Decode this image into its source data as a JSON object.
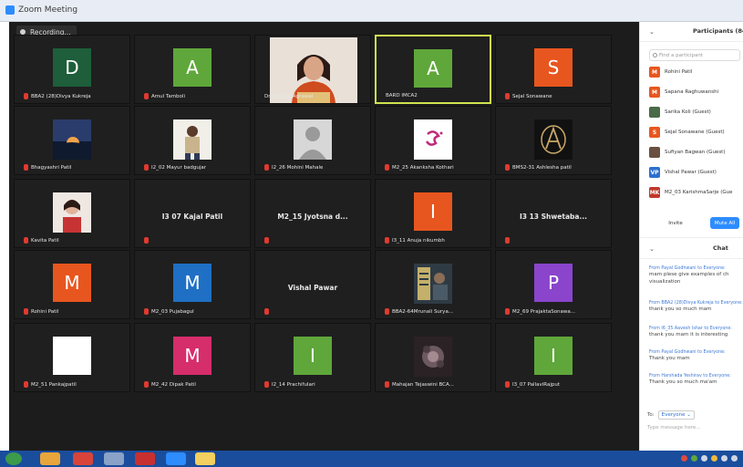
{
  "window": {
    "title": "Zoom Meeting"
  },
  "recording": {
    "label": "Recording..."
  },
  "tiles": [
    {
      "kind": "avatar",
      "letter": "D",
      "color": "#1e5e3a",
      "name": "BBA2 (28)Divya Kukreja",
      "muted": true
    },
    {
      "kind": "avatar",
      "letter": "A",
      "color": "#5fa73a",
      "name": "Amul Tamboli",
      "muted": true
    },
    {
      "kind": "video",
      "name": "Dr. Monika Agrawal",
      "muted": false
    },
    {
      "kind": "avatar",
      "letter": "A",
      "color": "#5fa73a",
      "name": "BARD IMCA2",
      "muted": false,
      "active": true
    },
    {
      "kind": "avatar",
      "letter": "S",
      "color": "#e8561f",
      "name": "Sejal Sonawane",
      "muted": true
    },
    {
      "kind": "photo",
      "photo": "sunset",
      "name": "Bhagyashri Patil",
      "muted": true
    },
    {
      "kind": "photo",
      "photo": "man",
      "name": "I2_02 Mayur badgujar",
      "muted": true
    },
    {
      "kind": "photo",
      "photo": "silhouette",
      "name": "I2_26 Mohini Mahale",
      "muted": true
    },
    {
      "kind": "photo",
      "photo": "letter-pink",
      "name": "M2_25 Akanksha Kothari",
      "muted": true
    },
    {
      "kind": "photo",
      "photo": "letter-gold",
      "name": "BMS2-31 Ashlesha patil",
      "muted": true
    },
    {
      "kind": "photo",
      "photo": "girl",
      "name": "Kavita Patil",
      "muted": true
    },
    {
      "kind": "text",
      "center": "I3 07 Kajal Patil",
      "name": "",
      "muted": true
    },
    {
      "kind": "text",
      "center": "M2_15 Jyotsna d...",
      "name": "",
      "muted": true
    },
    {
      "kind": "avatar",
      "letter": "I",
      "color": "#e8561f",
      "name": "I3_11 Anuja nikumbh",
      "muted": true
    },
    {
      "kind": "text",
      "center": "I3 13 Shwetaba...",
      "name": "",
      "muted": true
    },
    {
      "kind": "avatar",
      "letter": "M",
      "color": "#e8561f",
      "name": "Rohini Patil",
      "muted": true
    },
    {
      "kind": "avatar",
      "letter": "M",
      "color": "#1f6fc4",
      "name": "M2_03 Pujabagul",
      "muted": true
    },
    {
      "kind": "text",
      "center": "Vishal Pawar",
      "name": "",
      "muted": true
    },
    {
      "kind": "photo",
      "photo": "poster",
      "name": "BBA2-64Mrunali Surya...",
      "muted": true
    },
    {
      "kind": "avatar",
      "letter": "P",
      "color": "#8a45cc",
      "name": "M2_69 PrajaktaSonawa...",
      "muted": true
    },
    {
      "kind": "avatar",
      "letter": "",
      "color": "#ffffff",
      "name": "M2_51 Pankajpatil",
      "muted": true
    },
    {
      "kind": "avatar",
      "letter": "M",
      "color": "#d62d6b",
      "name": "M2_42 Dipak Patil",
      "muted": true
    },
    {
      "kind": "avatar",
      "letter": "I",
      "color": "#5fa73a",
      "name": "I2_14 Prachifulari",
      "muted": true
    },
    {
      "kind": "photo",
      "photo": "flower",
      "name": "Mahajan Tejaswini BCA...",
      "muted": true
    },
    {
      "kind": "avatar",
      "letter": "I",
      "color": "#5fa73a",
      "name": "I3_07 PallaviRajput",
      "muted": true
    }
  ],
  "participants": {
    "title": "Participants (84)",
    "search_placeholder": "Find a participant",
    "items": [
      {
        "initial": "M",
        "color": "#e8561f",
        "name": "Rohini Patil"
      },
      {
        "initial": "M",
        "color": "#e8561f",
        "name": "Sapana Raghuwanshi"
      },
      {
        "initial": "",
        "color": "#4a6a48",
        "name": "Sarika Koli (Guest)"
      },
      {
        "initial": "S",
        "color": "#e8561f",
        "name": "Sejal Sonawane (Guest)"
      },
      {
        "initial": "",
        "color": "#6a5040",
        "name": "Sufiyan Bagwan (Guest)"
      },
      {
        "initial": "VP",
        "color": "#2d6fd0",
        "name": "Vishal Pawar (Guest)"
      },
      {
        "initial": "MK",
        "color": "#c0392b",
        "name": "M2_03 KarishmaSarje (Gue"
      }
    ],
    "invite_label": "Invite",
    "mute_all_label": "Mute All"
  },
  "chat": {
    "title": "Chat",
    "messages": [
      {
        "from": "From Payal Godhwani to Everyone:",
        "lines": [
          "mam plese give examples of ch",
          "visualization"
        ]
      },
      {
        "from": "From BBA2 (28)Divya Kukreja to Everyone:",
        "lines": [
          "thank you so much mam"
        ]
      },
      {
        "from": "From I6_35 Aavesh Ishar to Everyone:",
        "lines": [
          "thank you mam it is interesting"
        ]
      },
      {
        "from": "From Payal Godhwani to Everyone:",
        "lines": [
          "Thank you mam"
        ]
      },
      {
        "from": "From Harshada Yeshirav to Everyone:",
        "lines": [
          "Thank you so much ma'am"
        ]
      }
    ],
    "to_label": "To:",
    "to_value": "Everyone",
    "input_placeholder": "Type message here..."
  }
}
